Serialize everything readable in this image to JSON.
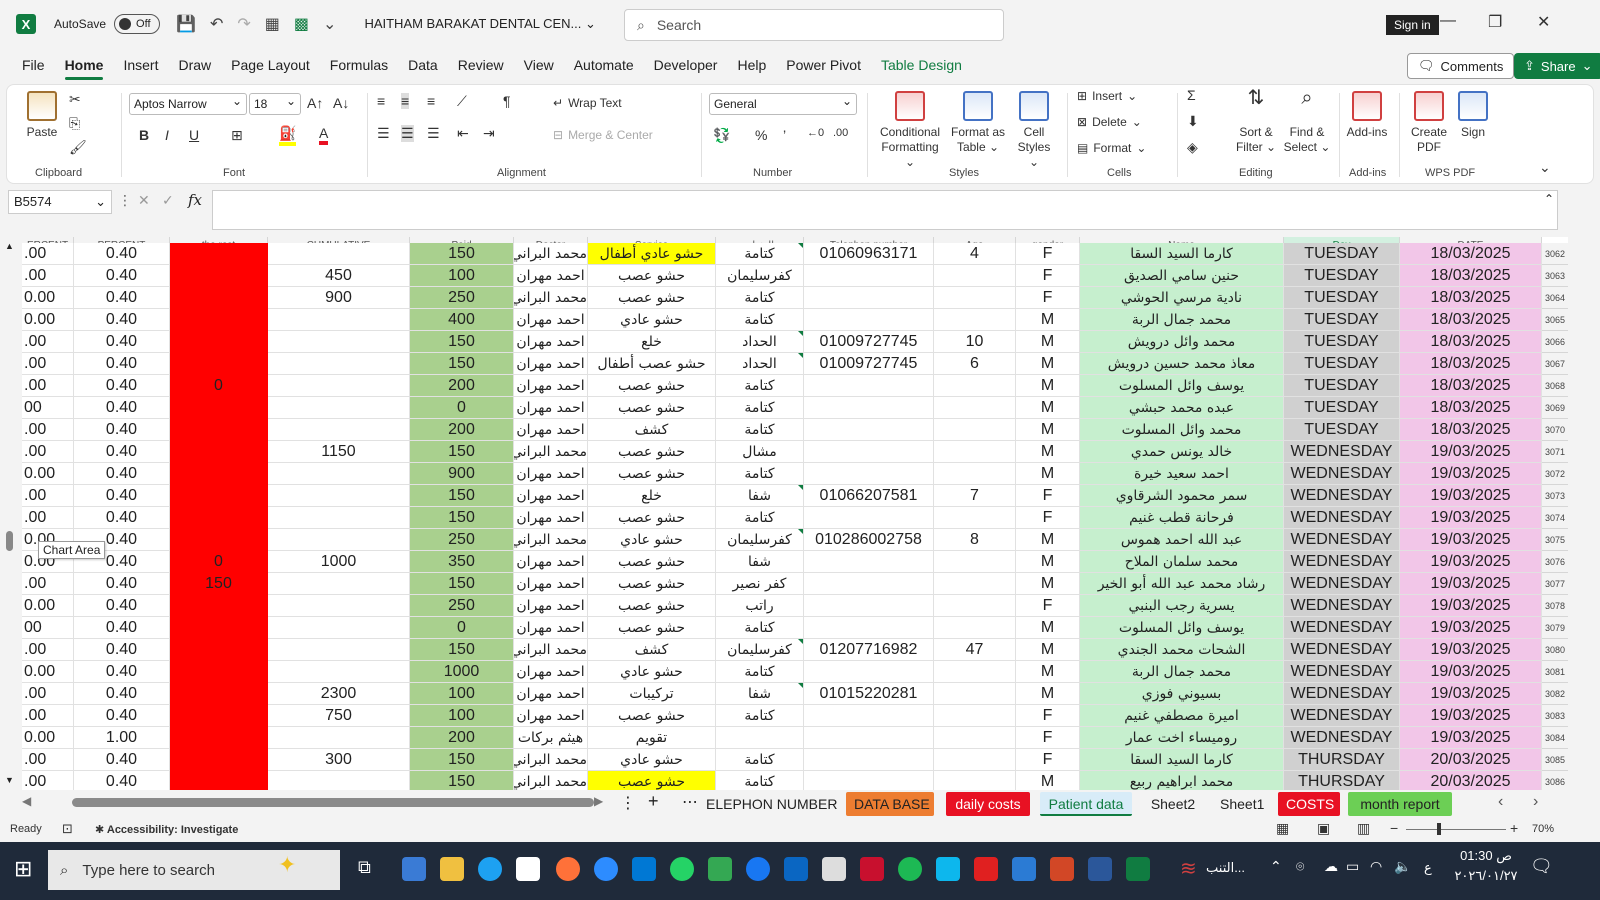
{
  "title": {
    "autosave_label": "AutoSave",
    "autosave_state": "Off",
    "filename": "HAITHAM BARAKAT DENTAL CEN...",
    "search_placeholder": "Search",
    "sign_in": "Sign in"
  },
  "menu": [
    "File",
    "Home",
    "Insert",
    "Draw",
    "Page Layout",
    "Formulas",
    "Data",
    "Review",
    "View",
    "Automate",
    "Developer",
    "Help",
    "Power Pivot",
    "Table Design"
  ],
  "active_menu": "Home",
  "comments_label": "Comments",
  "share_label": "Share",
  "ribbon": {
    "clipboard": {
      "paste": "Paste",
      "label": "Clipboard"
    },
    "font": {
      "name": "Aptos Narrow",
      "size": "18",
      "label": "Font"
    },
    "alignment": {
      "wrap": "Wrap Text",
      "merge": "Merge & Center",
      "label": "Alignment"
    },
    "number": {
      "format": "General",
      "label": "Number"
    },
    "styles": {
      "cond1": "Conditional",
      "cond2": "Formatting",
      "fmt1": "Format as",
      "fmt2": "Table",
      "cell1": "Cell",
      "cell2": "Styles",
      "label": "Styles"
    },
    "cells": {
      "insert": "Insert",
      "delete": "Delete",
      "format": "Format",
      "label": "Cells"
    },
    "editing": {
      "sort1": "Sort &",
      "sort2": "Filter",
      "find1": "Find &",
      "find2": "Select",
      "label": "Editing"
    },
    "addins": {
      "addins": "Add-ins",
      "label": "Add-ins"
    },
    "wps": {
      "create1": "Create",
      "create2": "PDF",
      "sign": "Sign",
      "label": "WPS PDF"
    }
  },
  "formula_bar": {
    "name_box": "B5574",
    "fx": "fx"
  },
  "headers": [
    "ERCENT",
    "PERCENT",
    "the rest",
    "CUMULATIVE",
    "Paid",
    "Doctor",
    "Service",
    "العنوان",
    "Telephon number",
    "Age",
    "gender",
    "Name",
    "Day",
    "DATE"
  ],
  "rows": [
    {
      "n": "3062",
      "a": ".00",
      "b": "0.40",
      "c": "",
      "d": "",
      "paid": "150",
      "doc": "محمد البراني",
      "svc": "حشو عادي أطفال",
      "addr": "كتامة",
      "tel": "01060963171",
      "age": "4",
      "g": "F",
      "name": "كارما السيد السقا",
      "day": "TUESDAY",
      "date": "18/03/2025"
    },
    {
      "n": "3063",
      "a": ".00",
      "b": "0.40",
      "c": "",
      "d": "450",
      "paid": "100",
      "doc": "احمد مهران",
      "svc": "حشو عصب",
      "addr": "كفرسليمان",
      "tel": "",
      "age": "",
      "g": "F",
      "name": "حنين سامي الصديق",
      "day": "TUESDAY",
      "date": "18/03/2025"
    },
    {
      "n": "3064",
      "a": "0.00",
      "b": "0.40",
      "c": "",
      "d": "900",
      "paid": "250",
      "doc": "محمد البراني",
      "svc": "حشو عصب",
      "addr": "كتامة",
      "tel": "",
      "age": "",
      "g": "F",
      "name": "نادية مرسي الحوشي",
      "day": "TUESDAY",
      "date": "18/03/2025"
    },
    {
      "n": "3065",
      "a": "0.00",
      "b": "0.40",
      "c": "",
      "d": "",
      "paid": "400",
      "doc": "احمد مهران",
      "svc": "حشو عادي",
      "addr": "كتامة",
      "tel": "",
      "age": "",
      "g": "M",
      "name": "محمد جمال الربة",
      "day": "TUESDAY",
      "date": "18/03/2025"
    },
    {
      "n": "3066",
      "a": ".00",
      "b": "0.40",
      "c": "",
      "d": "",
      "paid": "150",
      "doc": "احمد مهران",
      "svc": "خلع",
      "addr": "الحداد",
      "tel": "01009727745",
      "age": "10",
      "g": "M",
      "name": "محمد وائل درويش",
      "day": "TUESDAY",
      "date": "18/03/2025"
    },
    {
      "n": "3067",
      "a": ".00",
      "b": "0.40",
      "c": "",
      "d": "",
      "paid": "150",
      "doc": "احمد مهران",
      "svc": "حشو عصب أطفال",
      "addr": "الحداد",
      "tel": "01009727745",
      "age": "6",
      "g": "M",
      "name": "معاذ محمد حسين درويش",
      "day": "TUESDAY",
      "date": "18/03/2025"
    },
    {
      "n": "3068",
      "a": ".00",
      "b": "0.40",
      "c": "0",
      "d": "",
      "paid": "200",
      "doc": "احمد مهران",
      "svc": "حشو عصب",
      "addr": "كتامة",
      "tel": "",
      "age": "",
      "g": "M",
      "name": "يوسف وائل المسلوت",
      "day": "TUESDAY",
      "date": "18/03/2025"
    },
    {
      "n": "3069",
      "a": "00",
      "b": "0.40",
      "c": "",
      "d": "",
      "paid": "0",
      "doc": "احمد مهران",
      "svc": "حشو عصب",
      "addr": "كتامة",
      "tel": "",
      "age": "",
      "g": "M",
      "name": "عبده محمد حبشي",
      "day": "TUESDAY",
      "date": "18/03/2025"
    },
    {
      "n": "3070",
      "a": ".00",
      "b": "0.40",
      "c": "",
      "d": "",
      "paid": "200",
      "doc": "احمد مهران",
      "svc": "كشف",
      "addr": "كتامة",
      "tel": "",
      "age": "",
      "g": "M",
      "name": "محمد وائل المسلوت",
      "day": "TUESDAY",
      "date": "18/03/2025"
    },
    {
      "n": "3071",
      "a": ".00",
      "b": "0.40",
      "c": "",
      "d": "1150",
      "paid": "150",
      "doc": "محمد البراني",
      "svc": "حشو عصب",
      "addr": "مشال",
      "tel": "",
      "age": "",
      "g": "M",
      "name": "خالد يونس حمدي",
      "day": "WEDNESDAY",
      "date": "19/03/2025"
    },
    {
      "n": "3072",
      "a": "0.00",
      "b": "0.40",
      "c": "",
      "d": "",
      "paid": "900",
      "doc": "احمد مهران",
      "svc": "حشو عصب",
      "addr": "كتامة",
      "tel": "",
      "age": "",
      "g": "M",
      "name": "احمد سعيد خيرة",
      "day": "WEDNESDAY",
      "date": "19/03/2025"
    },
    {
      "n": "3073",
      "a": ".00",
      "b": "0.40",
      "c": "",
      "d": "",
      "paid": "150",
      "doc": "احمد مهران",
      "svc": "خلع",
      "addr": "شفا",
      "tel": "01066207581",
      "age": "7",
      "g": "F",
      "name": "سمر محمود الشرقاوي",
      "day": "WEDNESDAY",
      "date": "19/03/2025"
    },
    {
      "n": "3074",
      "a": ".00",
      "b": "0.40",
      "c": "",
      "d": "",
      "paid": "150",
      "doc": "احمد مهران",
      "svc": "حشو عصب",
      "addr": "كتامة",
      "tel": "",
      "age": "",
      "g": "F",
      "name": "فرحانة قطب غنيم",
      "day": "WEDNESDAY",
      "date": "19/03/2025"
    },
    {
      "n": "3075",
      "a": "0.00",
      "b": "0.40",
      "c": "",
      "d": "",
      "paid": "250",
      "doc": "محمد البراني",
      "svc": "حشو عادي",
      "addr": "كفرسليمان",
      "tel": "010286002758",
      "age": "8",
      "g": "M",
      "name": "عبد الله احمد هموس",
      "day": "WEDNESDAY",
      "date": "19/03/2025"
    },
    {
      "n": "3076",
      "a": "0.00",
      "b": "0.40",
      "c": "0",
      "d": "1000",
      "paid": "350",
      "doc": "احمد مهران",
      "svc": "حشو عصب",
      "addr": "شفا",
      "tel": "",
      "age": "",
      "g": "M",
      "name": "محمد سلمان الملاح",
      "day": "WEDNESDAY",
      "date": "19/03/2025"
    },
    {
      "n": "3077",
      "a": ".00",
      "b": "0.40",
      "c": "150",
      "d": "",
      "paid": "150",
      "doc": "احمد مهران",
      "svc": "حشو عصب",
      "addr": "كفر نصير",
      "tel": "",
      "age": "",
      "g": "M",
      "name": "رشاد محمد عبد الله أبو الخير",
      "day": "WEDNESDAY",
      "date": "19/03/2025"
    },
    {
      "n": "3078",
      "a": "0.00",
      "b": "0.40",
      "c": "",
      "d": "",
      "paid": "250",
      "doc": "احمد مهران",
      "svc": "حشو عصب",
      "addr": "راتب",
      "tel": "",
      "age": "",
      "g": "F",
      "name": "يسرية رجب البنبي",
      "day": "WEDNESDAY",
      "date": "19/03/2025"
    },
    {
      "n": "3079",
      "a": "00",
      "b": "0.40",
      "c": "",
      "d": "",
      "paid": "0",
      "doc": "احمد مهران",
      "svc": "حشو عصب",
      "addr": "كتامة",
      "tel": "",
      "age": "",
      "g": "M",
      "name": "يوسف وائل المسلوت",
      "day": "WEDNESDAY",
      "date": "19/03/2025"
    },
    {
      "n": "3080",
      "a": ".00",
      "b": "0.40",
      "c": "",
      "d": "",
      "paid": "150",
      "doc": "محمد البراني",
      "svc": "كشف",
      "addr": "كفرسليمان",
      "tel": "01207716982",
      "age": "47",
      "g": "M",
      "name": "الشحات محمد الجندي",
      "day": "WEDNESDAY",
      "date": "19/03/2025"
    },
    {
      "n": "3081",
      "a": "0.00",
      "b": "0.40",
      "c": "",
      "d": "",
      "paid": "1000",
      "doc": "احمد مهران",
      "svc": "حشو عادي",
      "addr": "كتامة",
      "tel": "",
      "age": "",
      "g": "M",
      "name": "محمد جمال الربة",
      "day": "WEDNESDAY",
      "date": "19/03/2025"
    },
    {
      "n": "3082",
      "a": ".00",
      "b": "0.40",
      "c": "",
      "d": "2300",
      "paid": "100",
      "doc": "احمد مهران",
      "svc": "تركيبات",
      "addr": "شفا",
      "tel": "01015220281",
      "age": "",
      "g": "M",
      "name": "بسيوني فوزي",
      "day": "WEDNESDAY",
      "date": "19/03/2025"
    },
    {
      "n": "3083",
      "a": ".00",
      "b": "0.40",
      "c": "",
      "d": "750",
      "paid": "100",
      "doc": "احمد مهران",
      "svc": "حشو عصب",
      "addr": "كتامة",
      "tel": "",
      "age": "",
      "g": "F",
      "name": "اميرة مصطفي غنيم",
      "day": "WEDNESDAY",
      "date": "19/03/2025"
    },
    {
      "n": "3084",
      "a": "0.00",
      "b": "1.00",
      "c": "",
      "d": "",
      "paid": "200",
      "doc": "هيثم بركات",
      "svc": "تقويم",
      "addr": "",
      "tel": "",
      "age": "",
      "g": "F",
      "name": "روميساء اخت عمار",
      "day": "WEDNESDAY",
      "date": "19/03/2025"
    },
    {
      "n": "3085",
      "a": ".00",
      "b": "0.40",
      "c": "",
      "d": "300",
      "paid": "150",
      "doc": "محمد البراني",
      "svc": "حشو عادي",
      "addr": "كتامة",
      "tel": "",
      "age": "",
      "g": "F",
      "name": "كارما السيد السقا",
      "day": "THURSDAY",
      "date": "20/03/2025"
    },
    {
      "n": "3086",
      "a": ".00",
      "b": "0.40",
      "c": "",
      "d": "",
      "paid": "150",
      "doc": "محمد البراني",
      "svc": "حشو عصب",
      "addr": "كتامة",
      "tel": "",
      "age": "",
      "g": "M",
      "name": "محمد ابراهيم ربيع",
      "day": "THURSDAY",
      "date": "20/03/2025"
    }
  ],
  "tooltip": "Chart Area",
  "sheet_tabs": [
    {
      "label": "ELEPHON NUMBER",
      "bg": "#f3f3f3",
      "color": "#222"
    },
    {
      "label": "DATA BASE",
      "bg": "#ed7d31",
      "color": "#222"
    },
    {
      "label": "daily costs",
      "bg": "#e81123",
      "color": "#fff"
    },
    {
      "label": "Patient data",
      "bg": "#d8ecf8",
      "color": "#222"
    },
    {
      "label": "Sheet2",
      "bg": "#f3f3f3",
      "color": "#222"
    },
    {
      "label": "Sheet1",
      "bg": "#f3f3f3",
      "color": "#222"
    },
    {
      "label": "COSTS",
      "bg": "#e81123",
      "color": "#fff"
    },
    {
      "label": "month report",
      "bg": "#6ccf55",
      "color": "#222"
    }
  ],
  "status": {
    "ready": "Ready",
    "accessibility": "Accessibility: Investigate",
    "zoom": "70%"
  },
  "taskbar": {
    "search": "Type here to search",
    "time": "01:30 ص",
    "date": "٢٠٢٦/٠١/٢٧",
    "lang": "ع",
    "weather": "التنب..."
  },
  "colors": {
    "excel_green": "#107c41",
    "red_col": "#ff0000",
    "paid_green": "#a9d08e",
    "name_green": "#c6efce",
    "day_gray": "#d0d0d0",
    "date_pink": "#f2c6e8",
    "yellow": "#ffff00"
  }
}
